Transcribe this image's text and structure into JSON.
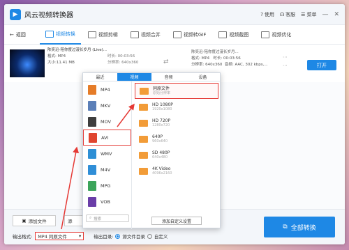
{
  "app": {
    "title": "风云视频转换器",
    "help": "使用",
    "service": "客服",
    "menu": "菜单"
  },
  "toolbar": {
    "back": "返回",
    "tools": [
      {
        "label": "视频转换",
        "active": true
      },
      {
        "label": "视频剪辑",
        "active": false
      },
      {
        "label": "视频合并",
        "active": false
      },
      {
        "label": "视频转GIF",
        "active": false
      },
      {
        "label": "视频截图",
        "active": false
      },
      {
        "label": "视频优化",
        "active": false
      }
    ]
  },
  "file": {
    "name": "陈奕迅-陪你度过漫长岁月 (Live)...",
    "format": "格式: MP4",
    "duration": "时长: 00:03:56",
    "size": "大小:11.41 MB",
    "resolution": "分辨率: 640x360",
    "out_name": "陈奕迅-陪你度过漫长岁月...",
    "out_format": "格式: MP4",
    "out_duration": "时长: 00:03:56",
    "out_resolution": "分辨率: 640x360",
    "out_audio": "音频: AAC, 302 kbps,...",
    "open": "打开"
  },
  "popup": {
    "tabs": [
      {
        "label": "最近",
        "active": false
      },
      {
        "label": "视频",
        "active": true
      },
      {
        "label": "音频",
        "active": false
      },
      {
        "label": "设备",
        "active": false
      }
    ],
    "formats": [
      {
        "label": "MP4",
        "color": "#e57c28",
        "selected": false
      },
      {
        "label": "MKV",
        "color": "#5b7fb8",
        "selected": false
      },
      {
        "label": "MOV",
        "color": "#3e3e3e",
        "selected": false
      },
      {
        "label": "AVI",
        "color": "#e0452f",
        "selected": true
      },
      {
        "label": "WMV",
        "color": "#2d8fd5",
        "selected": false
      },
      {
        "label": "M4V",
        "color": "#2f8ed7",
        "selected": false
      },
      {
        "label": "MPG",
        "color": "#3ba45a",
        "selected": false
      },
      {
        "label": "VOB",
        "color": "#6a3da8",
        "selected": false
      }
    ],
    "search_placeholder": "搜索",
    "resolutions": [
      {
        "title": "同原文件",
        "sub": "原始分辨率",
        "selected": true
      },
      {
        "title": "HD 1080P",
        "sub": "1920x1080",
        "selected": false
      },
      {
        "title": "HD 720P",
        "sub": "1280x720",
        "selected": false
      },
      {
        "title": "640P",
        "sub": "960x640",
        "selected": false
      },
      {
        "title": "SD 480P",
        "sub": "640x480",
        "selected": false
      },
      {
        "title": "4K Video",
        "sub": "4096x2160",
        "selected": false
      }
    ],
    "add_custom": "添加自定义设置"
  },
  "bottom": {
    "add_file": "添加文件",
    "add_folder": "添",
    "output_format_label": "输出格式:",
    "output_format_value": "MP4 同原文件",
    "output_dir_label": "输出目录:",
    "dir_option_source": "源文件目录",
    "dir_option_custom": "自定义",
    "convert_all": "全部转换"
  },
  "colors": {
    "accent": "#1e88e5",
    "highlight": "#e53935",
    "film": "#f29c38"
  }
}
